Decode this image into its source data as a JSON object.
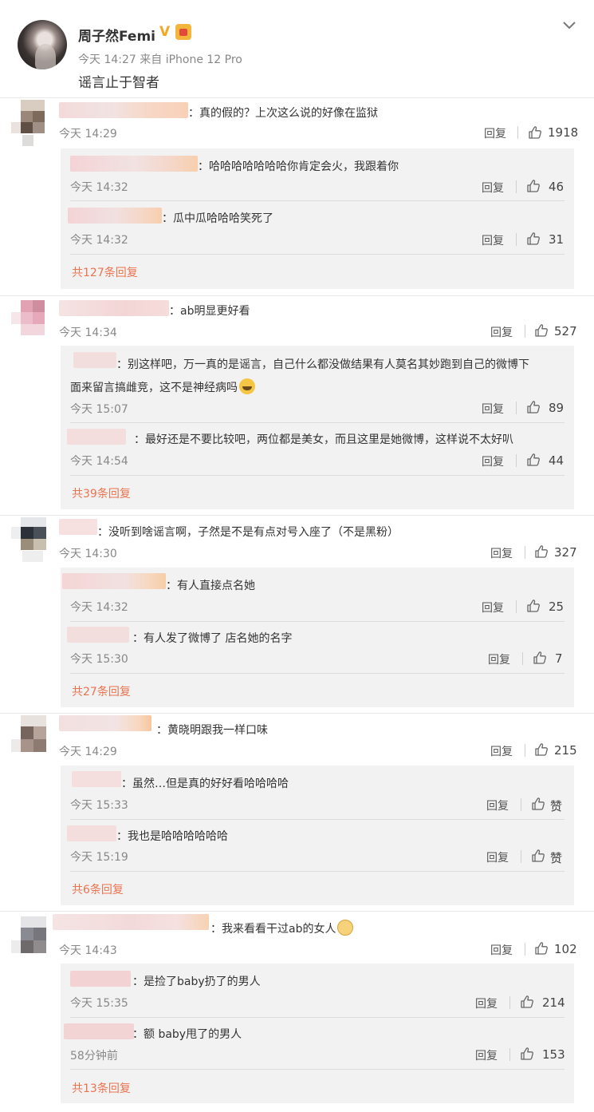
{
  "post": {
    "author": "周子然Femi",
    "time_source": "今天 14:27 来自 iPhone 12 Pro",
    "text": "谣言止于智者"
  },
  "ui": {
    "reply": "回复"
  },
  "threads": [
    {
      "text": "：真的假的？上次这么说的好像在监狱",
      "time": "今天 14:29",
      "likes": "1918",
      "replies": [
        {
          "text": "：哈哈哈哈哈哈哈你肯定会火，我跟着你",
          "time": "今天 14:32",
          "likes": "46"
        },
        {
          "text": "：瓜中瓜哈哈哈笑死了",
          "time": "今天 14:32",
          "likes": "31"
        }
      ],
      "more": "共127条回复"
    },
    {
      "text": "：ab明显更好看",
      "time": "今天 14:34",
      "likes": "527",
      "replies": [
        {
          "text": "：别这样吧，万一真的是谣言，自己什么都没做结果有人莫名其妙跑到自己的微博下",
          "text2": "面来留言搞雌竞，这不是神经病吗",
          "time": "今天 15:07",
          "likes": "89"
        },
        {
          "text": "：最好还是不要比较吧，两位都是美女，而且这里是她微博，这样说不太好叭",
          "time": "今天 14:54",
          "likes": "44"
        }
      ],
      "more": "共39条回复"
    },
    {
      "text": "：没听到啥谣言啊，子然是不是有点对号入座了（不是黑粉）",
      "time": "今天 14:30",
      "likes": "327",
      "replies": [
        {
          "text": "：有人直接点名她",
          "time": "今天 14:32",
          "likes": "25"
        },
        {
          "text": "：有人发了微博了 店名她的名字",
          "time": "今天 15:30",
          "likes": "7"
        }
      ],
      "more": "共27条回复"
    },
    {
      "text": "：黄晓明跟我一样口味",
      "time": "今天 14:29",
      "likes": "215",
      "replies": [
        {
          "text": "：虽然…但是真的好好看哈哈哈哈",
          "time": "今天 15:33",
          "likes": "赞"
        },
        {
          "text": "：我也是哈哈哈哈哈哈",
          "time": "今天 15:19",
          "likes": "赞"
        }
      ],
      "more": "共6条回复"
    },
    {
      "text": "：我来看看干过ab的女人",
      "time": "今天 14:43",
      "likes": "102",
      "replies": [
        {
          "text": "：是捡了baby扔了的男人",
          "time": "今天 15:35",
          "likes": "214"
        },
        {
          "text": "：额 baby甩了的男人",
          "time": "58分钟前",
          "likes": "153"
        }
      ],
      "more": "共13条回复"
    }
  ]
}
